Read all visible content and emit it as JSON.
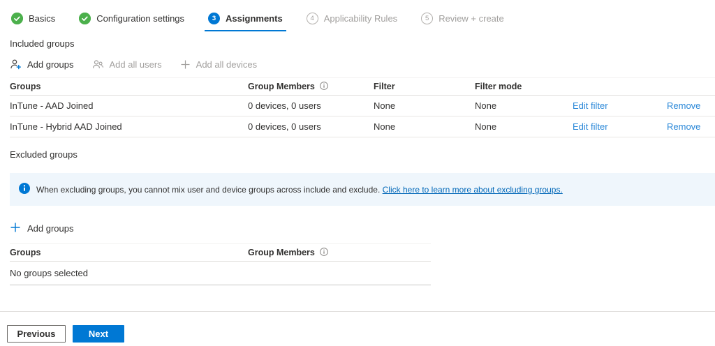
{
  "colors": {
    "accent": "#0078d4",
    "success_green": "#4cb04c",
    "banner_background": "#eff6fc",
    "link": "#2b88d8",
    "text": "#323130",
    "disabled_text": "#a19f9d"
  },
  "wizard": {
    "steps": [
      {
        "label": "Basics",
        "state": "completed",
        "icon": "check-circle-icon"
      },
      {
        "label": "Configuration settings",
        "state": "completed",
        "icon": "check-circle-icon"
      },
      {
        "label": "Assignments",
        "state": "current",
        "number": "3"
      },
      {
        "label": "Applicability Rules",
        "state": "upcoming",
        "number": "4"
      },
      {
        "label": "Review + create",
        "state": "upcoming",
        "number": "5"
      }
    ]
  },
  "included": {
    "title": "Included groups",
    "toolbar": {
      "add_groups": "Add groups",
      "add_all_users": "Add all users",
      "add_all_devices": "Add all devices"
    },
    "table": {
      "headers": {
        "groups": "Groups",
        "members": "Group Members",
        "filter": "Filter",
        "filter_mode": "Filter mode"
      },
      "rows": [
        {
          "group": "InTune - AAD Joined",
          "members": "0 devices, 0 users",
          "filter": "None",
          "filter_mode": "None",
          "edit": "Edit filter",
          "remove": "Remove"
        },
        {
          "group": "InTune - Hybrid AAD Joined",
          "members": "0 devices, 0 users",
          "filter": "None",
          "filter_mode": "None",
          "edit": "Edit filter",
          "remove": "Remove"
        }
      ]
    }
  },
  "excluded": {
    "title": "Excluded groups",
    "banner": {
      "text": "When excluding groups, you cannot mix user and device groups across include and exclude.",
      "link": "Click here to learn more about excluding groups."
    },
    "add_groups": "Add groups",
    "table": {
      "headers": {
        "groups": "Groups",
        "members": "Group Members"
      },
      "empty": "No groups selected"
    }
  },
  "footer": {
    "previous": "Previous",
    "next": "Next"
  }
}
